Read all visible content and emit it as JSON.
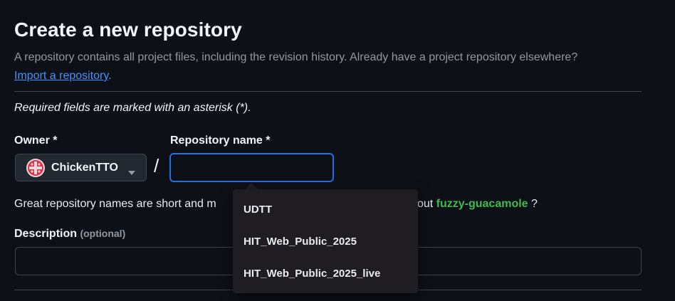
{
  "header": {
    "title": "Create a new repository",
    "subtitle": "A repository contains all project files, including the revision history. Already have a project repository elsewhere?",
    "import_link": "Import a repository",
    "import_suffix": "."
  },
  "form": {
    "required_note": "Required fields are marked with an asterisk (*).",
    "owner": {
      "label": "Owner *",
      "value": "ChickenTTO",
      "icon": "chevron-down-icon"
    },
    "separator": "/",
    "repo_name": {
      "label": "Repository name *",
      "value": ""
    },
    "hint": {
      "prefix": "Great repository names are short and m",
      "middle": "about",
      "suggestion": "fuzzy-guacamole",
      "suffix": "?"
    },
    "description": {
      "label": "Description",
      "optional": "(optional)",
      "value": ""
    }
  },
  "autocomplete": {
    "items": [
      "UDTT",
      "HIT_Web_Public_2025",
      "HIT_Web_Public_2025_live"
    ]
  },
  "colors": {
    "accent": "#1f6feb",
    "link": "#4493f8",
    "suggestion": "#3fb950",
    "avatar": "#d9334a"
  }
}
